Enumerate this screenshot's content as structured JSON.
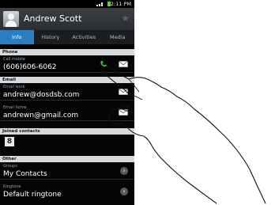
{
  "status_bar": {
    "time": "2:11 PM"
  },
  "contact": {
    "name": "Andrew Scott"
  },
  "tabs": [
    {
      "label": "Info",
      "active": true
    },
    {
      "label": "History",
      "active": false
    },
    {
      "label": "Activities",
      "active": false
    },
    {
      "label": "Media",
      "active": false
    }
  ],
  "sections": {
    "phone": "Phone",
    "email": "Email",
    "joined": "Joined contacts",
    "other": "Other"
  },
  "phone_row": {
    "label": "Call mobile",
    "value": "(606)606-6062"
  },
  "email_rows": [
    {
      "label": "Email work",
      "value": "andrew@dosdsb.com"
    },
    {
      "label": "Email home",
      "value": "andrewn@gmail.com"
    }
  ],
  "joined_icon": "8",
  "other_rows": [
    {
      "label": "Groups",
      "value": "My Contacts"
    },
    {
      "label": "Ringtone",
      "value": "Default ringtone"
    }
  ],
  "colors": {
    "tab_active": "#2b7fc0",
    "call_icon": "#3fb43f"
  }
}
